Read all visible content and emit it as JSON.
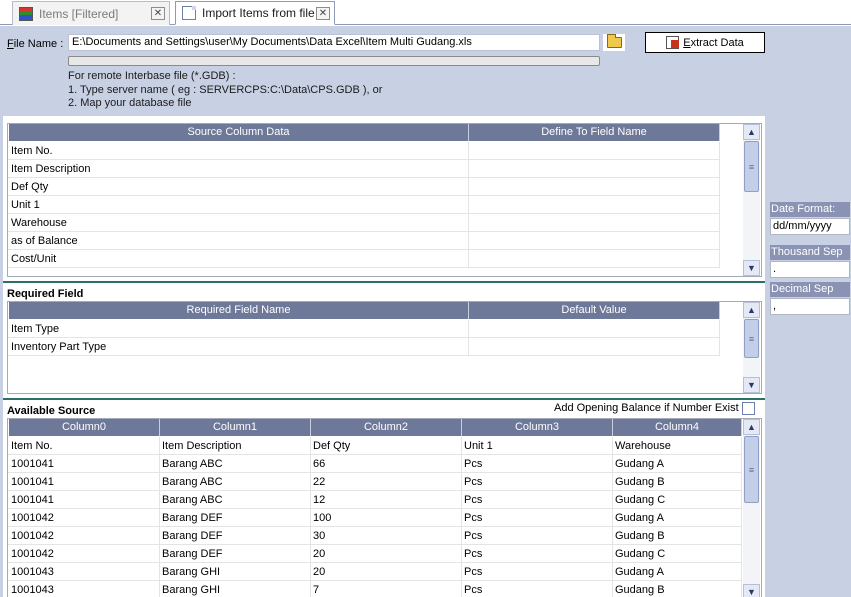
{
  "tabs": [
    {
      "label": "Items [Filtered]",
      "icon": "items-list-icon",
      "active": false
    },
    {
      "label": "Import Items from file",
      "icon": "document-icon",
      "active": true
    }
  ],
  "file": {
    "label_prefix": "F",
    "label_rest": "ile Name :",
    "path": "E:\\Documents and Settings\\user\\My Documents\\Data Excel\\Item Multi Gudang.xls"
  },
  "extract_button": {
    "prefix": "E",
    "rest": "xtract Data"
  },
  "hints": [
    "For remote Interbase file (*.GDB) :",
    "1. Type server name ( eg : SERVERCPS:C:\\Data\\CPS.GDB ), or",
    "2. Map your database file"
  ],
  "mapping_grid": {
    "headers": [
      "Source Column Data",
      "Define To Field Name"
    ],
    "rows": [
      [
        "Item No.",
        ""
      ],
      [
        "Item Description",
        ""
      ],
      [
        "Def Qty",
        ""
      ],
      [
        "Unit 1",
        ""
      ],
      [
        "Warehouse",
        ""
      ],
      [
        "as of Balance",
        ""
      ],
      [
        "Cost/Unit",
        ""
      ]
    ]
  },
  "required": {
    "title": "Required Field",
    "headers": [
      "Required Field Name",
      "Default Value"
    ],
    "rows": [
      [
        "Item Type",
        ""
      ],
      [
        "Inventory Part Type",
        ""
      ]
    ]
  },
  "available": {
    "title": "Available Source",
    "opening_balance_label": "Add Opening Balance if Number Exist",
    "headers": [
      "Column0",
      "Column1",
      "Column2",
      "Column3",
      "Column4"
    ],
    "rows": [
      [
        "Item No.",
        "Item Description",
        "Def Qty",
        "Unit 1",
        "Warehouse"
      ],
      [
        "1001041",
        "Barang ABC",
        "66",
        "Pcs",
        "Gudang A"
      ],
      [
        "1001041",
        "Barang ABC",
        "22",
        "Pcs",
        "Gudang B"
      ],
      [
        "1001041",
        "Barang ABC",
        "12",
        "Pcs",
        "Gudang C"
      ],
      [
        "1001042",
        "Barang DEF",
        "100",
        "Pcs",
        "Gudang A"
      ],
      [
        "1001042",
        "Barang DEF",
        "30",
        "Pcs",
        "Gudang B"
      ],
      [
        "1001042",
        "Barang DEF",
        "20",
        "Pcs",
        "Gudang C"
      ],
      [
        "1001043",
        "Barang GHI",
        "20",
        "Pcs",
        "Gudang A"
      ],
      [
        "1001043",
        "Barang GHI",
        "7",
        "Pcs",
        "Gudang B"
      ]
    ]
  },
  "side": {
    "date_format_label": "Date Format:",
    "date_format_value": "dd/mm/yyyy",
    "thousand_sep_label": "Thousand Sep",
    "thousand_sep_value": ".",
    "decimal_sep_label": "Decimal Sep",
    "decimal_sep_value": ","
  },
  "colors": {
    "panel_bg": "#c8d1e4",
    "grid_header": "#6e7898",
    "section_separator": "#2e6f6a"
  }
}
